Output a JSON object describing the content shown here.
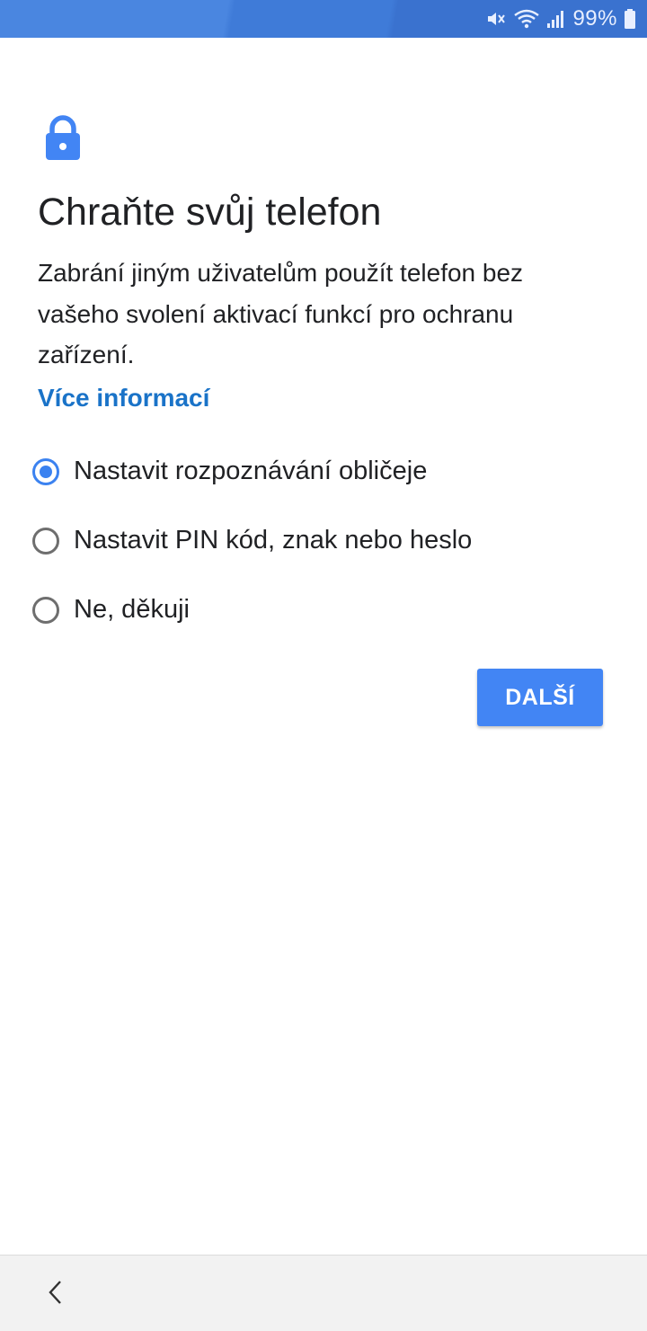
{
  "status_bar": {
    "battery_percent": "99%",
    "icons": [
      "mute-icon",
      "wifi-icon",
      "signal-icon",
      "battery-icon"
    ]
  },
  "colors": {
    "accent": "#4285f4",
    "link": "#1a73c8",
    "status_bar": "#4a86e0"
  },
  "screen": {
    "icon": "lock-icon",
    "title": "Chraňte svůj telefon",
    "description": "Zabrání jiným uživatelům použít telefon bez vašeho svolení aktivací funkcí pro ochranu zařízení.",
    "more_info_link": "Více informací",
    "options": [
      {
        "label": "Nastavit rozpoznávání obličeje",
        "selected": true
      },
      {
        "label": "Nastavit PIN kód, znak nebo heslo",
        "selected": false
      },
      {
        "label": "Ne, děkuji",
        "selected": false
      }
    ],
    "next_button": "DALŠÍ"
  },
  "bottom_nav": {
    "back_icon": "chevron-left-icon"
  }
}
